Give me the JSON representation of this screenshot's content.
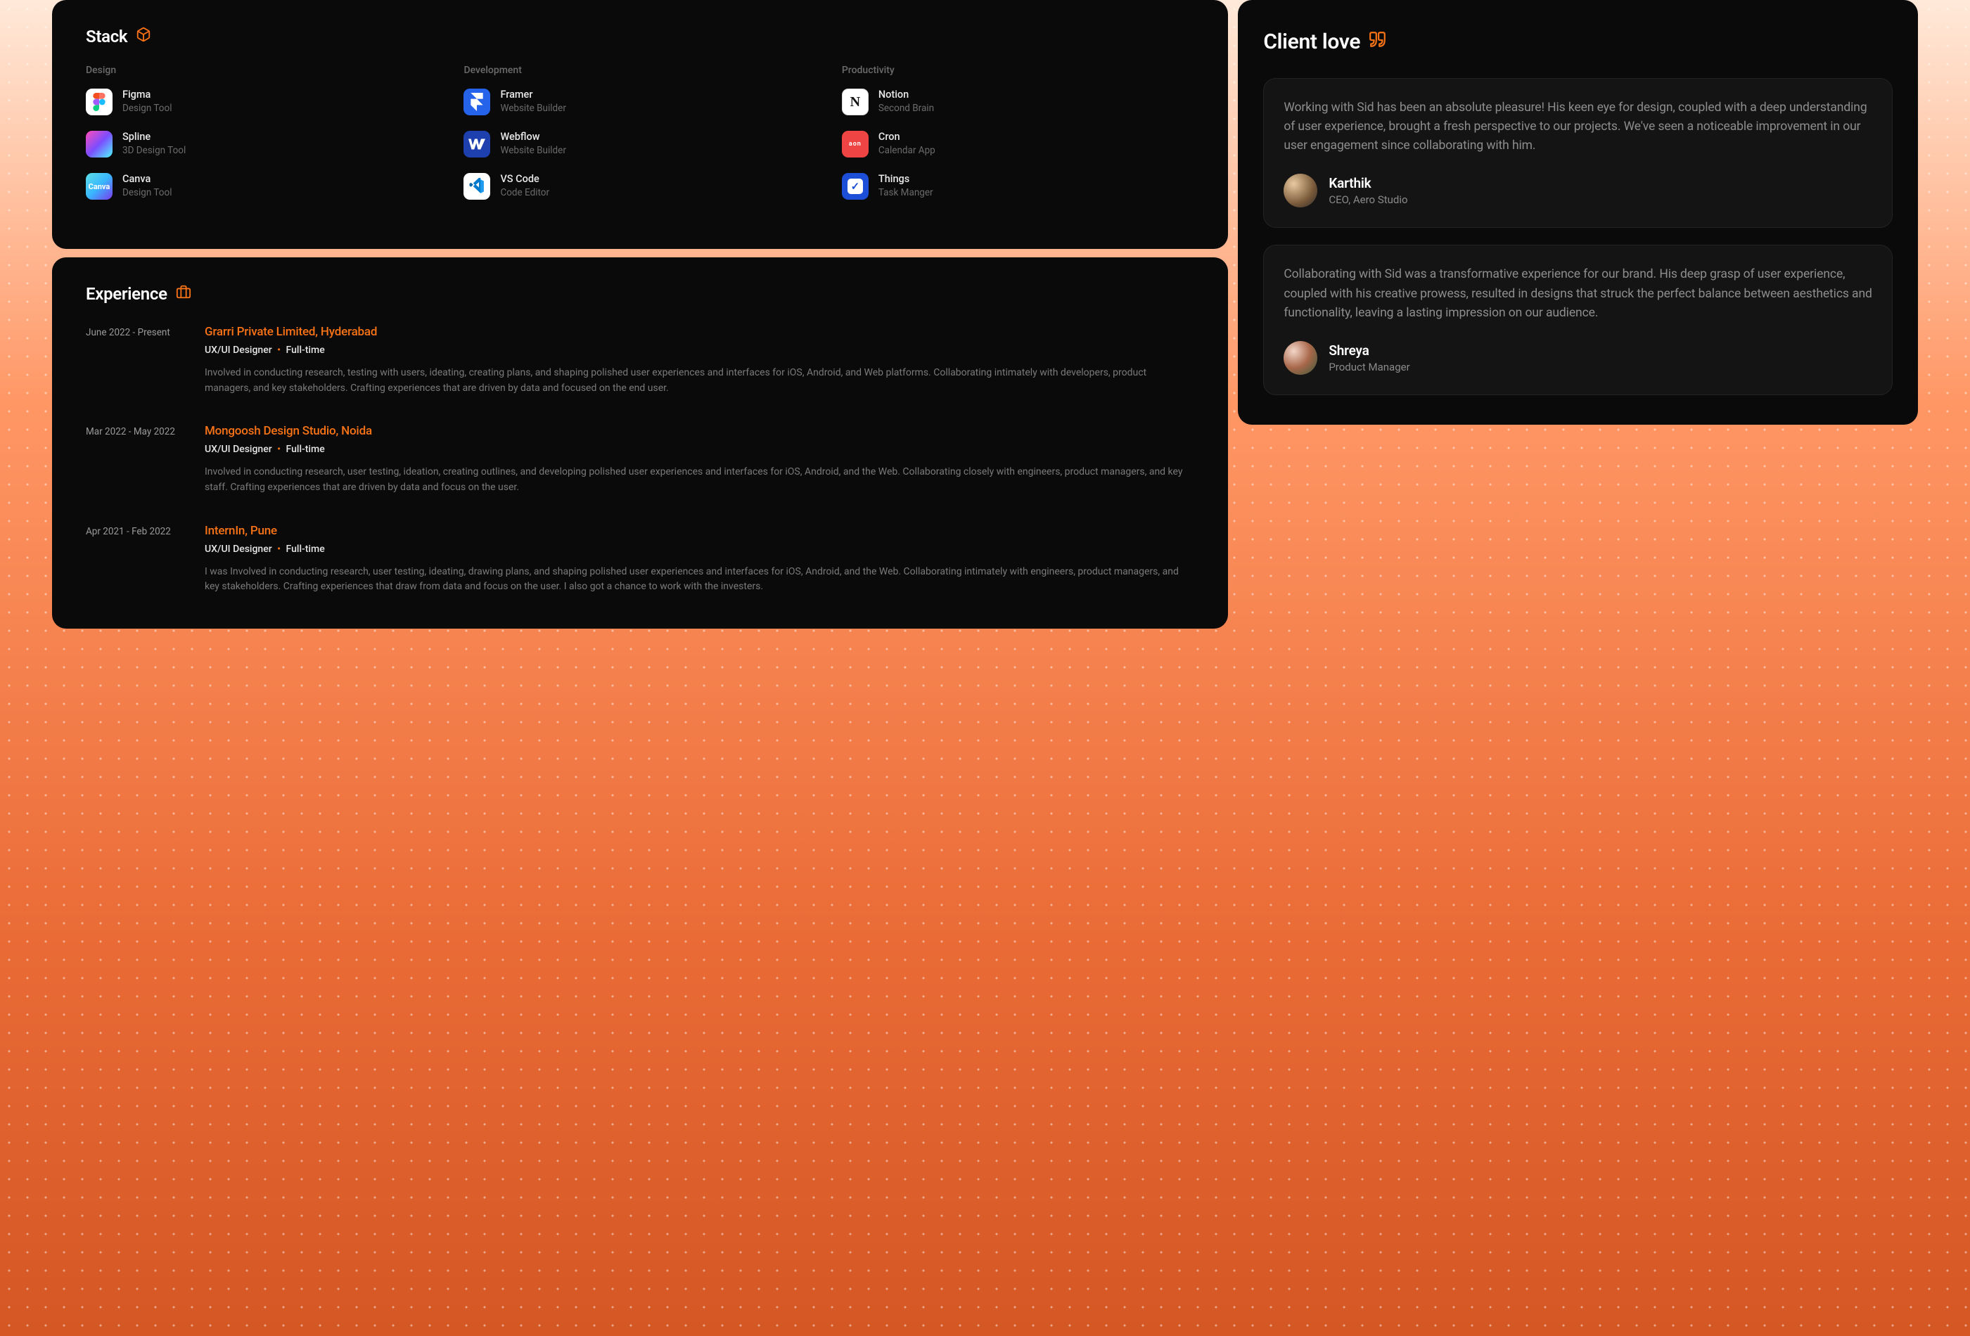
{
  "stack": {
    "title": "Stack",
    "columns": [
      {
        "label": "Design",
        "tools": [
          {
            "name": "Figma",
            "sub": "Design Tool",
            "icon": "figma"
          },
          {
            "name": "Spline",
            "sub": "3D Design Tool",
            "icon": "spline"
          },
          {
            "name": "Canva",
            "sub": "Design Tool",
            "icon": "canva"
          }
        ]
      },
      {
        "label": "Development",
        "tools": [
          {
            "name": "Framer",
            "sub": "Website Builder",
            "icon": "framer"
          },
          {
            "name": "Webflow",
            "sub": "Website Builder",
            "icon": "webflow"
          },
          {
            "name": "VS Code",
            "sub": "Code Editor",
            "icon": "vscode"
          }
        ]
      },
      {
        "label": "Productivity",
        "tools": [
          {
            "name": "Notion",
            "sub": "Second Brain",
            "icon": "notion"
          },
          {
            "name": "Cron",
            "sub": "Calendar App",
            "icon": "cron"
          },
          {
            "name": "Things",
            "sub": "Task Manger",
            "icon": "things"
          }
        ]
      }
    ]
  },
  "experience": {
    "title": "Experience",
    "items": [
      {
        "date": "June 2022 - Present",
        "company": "Grarri Private Limited, Hyderabad",
        "role": "UX/UI Designer",
        "type": "Full-time",
        "desc": "Involved in conducting research, testing with users, ideating, creating plans, and shaping polished user experiences and interfaces for iOS, Android, and Web platforms. Collaborating intimately with developers, product managers, and key stakeholders. Crafting experiences that are driven by data and focused on the end user."
      },
      {
        "date": "Mar 2022 - May 2022",
        "company": "Mongoosh Design Studio, Noida",
        "role": "UX/UI Designer",
        "type": "Full-time",
        "desc": "Involved in conducting research, user testing, ideation, creating outlines, and developing polished user experiences and interfaces for iOS, Android, and the Web. Collaborating closely with engineers, product managers, and key staff. Crafting experiences that are driven by data and focus on the user."
      },
      {
        "date": "Apr 2021 - Feb 2022",
        "company": "InternIn, Pune",
        "role": "UX/UI Designer",
        "type": "Full-time",
        "desc": "I was Involved in conducting research, user testing, ideating, drawing plans, and shaping polished user experiences and interfaces for iOS, Android, and the Web. Collaborating intimately with engineers, product managers, and key stakeholders. Crafting experiences that draw from data and focus on the user. I also got a chance to work with the investers."
      }
    ]
  },
  "testimonials": {
    "title": "Client love",
    "items": [
      {
        "text": "Working with Sid has been an absolute pleasure! His keen eye for design, coupled with a deep understanding of user experience, brought a fresh perspective to our projects. We've seen a noticeable improvement in our user engagement since collaborating with him.",
        "name": "Karthik",
        "role": "CEO, Aero Studio"
      },
      {
        "text": "Collaborating with Sid was a transformative experience for our brand. His deep grasp of user experience, coupled with his creative prowess, resulted in designs that struck the perfect balance between aesthetics and functionality, leaving a lasting impression on our audience.",
        "name": "Shreya",
        "role": "Product Manager"
      }
    ]
  }
}
